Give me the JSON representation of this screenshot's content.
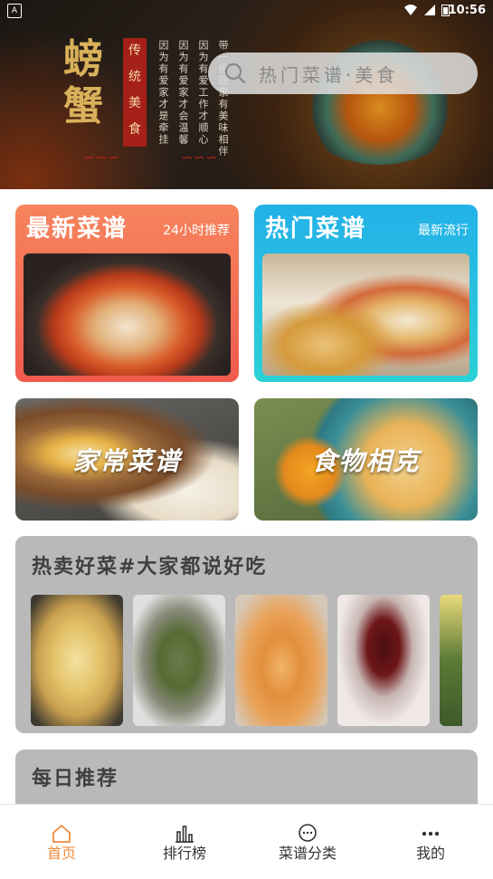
{
  "status_bar": {
    "time": "10:56"
  },
  "banner": {
    "title_chars": "螃蟹",
    "tag_chars": "传统美食",
    "vertical_lines": [
      "因为有爱家才是牵挂",
      "因为有爱家才会温馨",
      "因为有爱工作才顺心",
      "带一份回家有美味相伴"
    ],
    "search_placeholder": "热门菜谱·美食"
  },
  "cards": {
    "latest": {
      "title": "最新菜谱",
      "subtitle": "24小时推荐"
    },
    "hot": {
      "title": "热门菜谱",
      "subtitle": "最新流行"
    },
    "home": {
      "overlay": "家常菜谱"
    },
    "food": {
      "overlay": "食物相克"
    }
  },
  "hot_section": {
    "title": "热卖好菜#大家都说好吃"
  },
  "daily_section": {
    "title": "每日推荐"
  },
  "nav": {
    "items": [
      {
        "label": "首页",
        "icon": "home-icon",
        "active": true
      },
      {
        "label": "排行榜",
        "icon": "bar-chart-icon",
        "active": false
      },
      {
        "label": "菜谱分类",
        "icon": "chat-bubble-icon",
        "active": false
      },
      {
        "label": "我的",
        "icon": "more-dots-icon",
        "active": false
      }
    ]
  },
  "colors": {
    "accent": "#f08a3a",
    "latest_card": "#f26b52",
    "hot_card": "#26bfe0"
  }
}
